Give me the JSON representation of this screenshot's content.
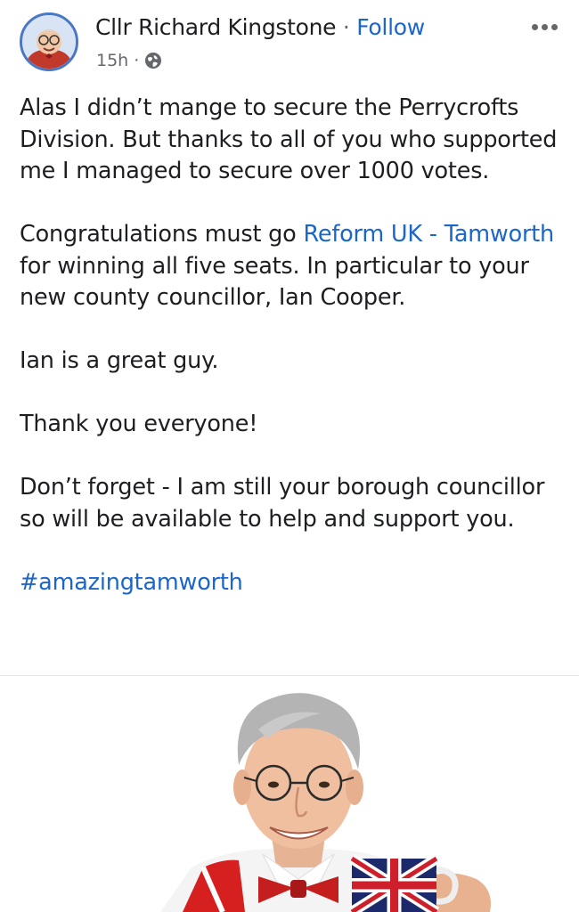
{
  "header": {
    "author_name": "Cllr Richard Kingstone",
    "separator": "·",
    "follow_label": "Follow",
    "time": "15h",
    "time_sep": "·",
    "audience_icon": "globe-icon",
    "more_icon": "more-options-icon"
  },
  "post": {
    "p1": "Alas I didn’t mange to secure the Perrycrofts Division. But thanks to all of you who supported me I managed to secure over 1000 votes.",
    "p2_before": "Congratulations must go ",
    "p2_link": "Reform UK - Tamworth",
    "p2_after": " for winning all five seats. In particular to your new county councillor, Ian Cooper.",
    "p3": "Ian is a great guy.",
    "p4": "Thank you everyone!",
    "p5": "Don’t forget - I am still your borough councillor so will be available to help and support you.",
    "hashtag": "#amazingtamworth"
  },
  "colors": {
    "link": "#1b66c9",
    "text": "#1c1e21",
    "meta": "#65676b",
    "avatar_ring": "#4a78c4"
  }
}
